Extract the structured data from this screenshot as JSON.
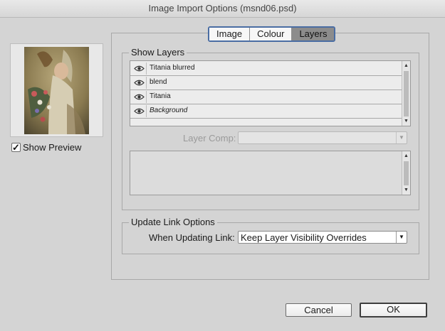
{
  "window": {
    "title": "Image Import Options (msnd06.psd)"
  },
  "preview": {
    "show_preview_label": "Show Preview",
    "checked": true
  },
  "tabs": [
    {
      "label": "Image",
      "active": false
    },
    {
      "label": "Colour",
      "active": false
    },
    {
      "label": "Layers",
      "active": true
    }
  ],
  "show_layers": {
    "legend": "Show Layers",
    "layers": [
      {
        "name": "Titania blurred",
        "visible": true,
        "italic": false
      },
      {
        "name": "blend",
        "visible": true,
        "italic": false
      },
      {
        "name": "Titania",
        "visible": true,
        "italic": false
      },
      {
        "name": "Background",
        "visible": true,
        "italic": true
      }
    ],
    "layer_comp_label": "Layer Comp:",
    "layer_comp_value": ""
  },
  "update_link": {
    "legend": "Update Link Options",
    "when_label": "When Updating Link:",
    "when_value": "Keep Layer Visibility Overrides"
  },
  "buttons": {
    "cancel": "Cancel",
    "ok": "OK"
  },
  "icons": {
    "layer_visibility": "eye-icon",
    "dropdown": "chevron-down-icon",
    "check": "checkmark-icon"
  }
}
